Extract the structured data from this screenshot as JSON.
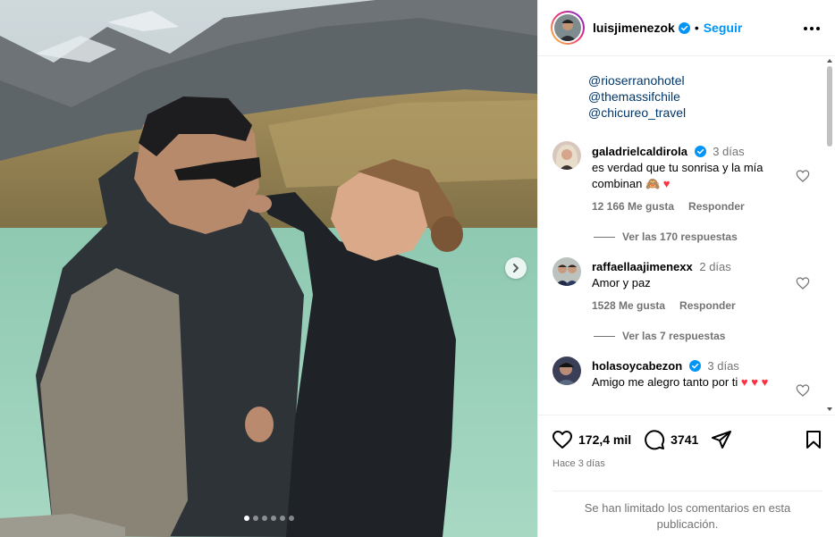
{
  "media": {
    "slide_count": 6,
    "active_slide": 1,
    "next_icon": "chevron-right-icon"
  },
  "header": {
    "username": "luisjimenezok",
    "separator": "•",
    "follow_label": "Seguir",
    "more_icon": "more-horizontal-icon"
  },
  "caption": {
    "mentions": [
      "@rioserranohotel",
      "@themassifchile",
      "@chicureo_travel"
    ]
  },
  "comments": [
    {
      "username": "galadrielcaldirola",
      "verified": true,
      "time": "3 días",
      "text": "es verdad que tu sonrisa y la mía combinan 🙈 ",
      "text_heart": "♥",
      "likes": "12 166 Me gusta",
      "reply_label": "Responder",
      "view_replies": "Ver las 170 respuestas"
    },
    {
      "username": "raffaellaajimenexx",
      "verified": false,
      "time": "2 días",
      "text": "Amor y paz",
      "likes": "1528 Me gusta",
      "reply_label": "Responder",
      "view_replies": "Ver las 7 respuestas"
    },
    {
      "username": "holasoycabezon",
      "verified": true,
      "time": "3 días",
      "text": "Amigo me alegro tanto por ti ",
      "text_hearts": "♥ ♥ ♥"
    }
  ],
  "actions": {
    "like_count": "172,4 mil",
    "comment_count": "3741",
    "posted": "Hace 3 días",
    "limited_notice": "Se han limitado los comentarios en esta publicación."
  },
  "colors": {
    "link": "#00376b",
    "follow": "#0095f6",
    "verified": "#0095f6",
    "heart": "#ff3040",
    "muted": "#737373"
  }
}
